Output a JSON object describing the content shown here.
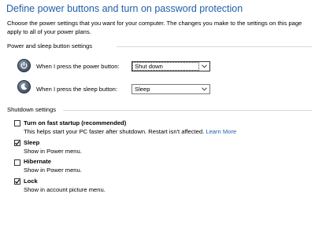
{
  "page": {
    "title": "Define power buttons and turn on password protection",
    "intro": "Choose the power settings that you want for your computer. The changes you make to the settings on this page apply to all of your power plans."
  },
  "power_group": {
    "header": "Power and sleep button settings",
    "power_button": {
      "label": "When I press the power button:",
      "value": "Shut down",
      "icon": "power-button-icon"
    },
    "sleep_button": {
      "label": "When I press the sleep button:",
      "value": "Sleep",
      "icon": "sleep-button-icon"
    }
  },
  "shutdown_group": {
    "header": "Shutdown settings",
    "options": [
      {
        "title": "Turn on fast startup (recommended)",
        "desc": "This helps start your PC faster after shutdown. Restart isn't affected.",
        "link": "Learn More",
        "checked": false
      },
      {
        "title": "Sleep",
        "desc": "Show in Power menu.",
        "checked": true
      },
      {
        "title": "Hibernate",
        "desc": "Show in Power menu.",
        "checked": false
      },
      {
        "title": "Lock",
        "desc": "Show in account picture menu.",
        "checked": true
      }
    ]
  },
  "colors": {
    "title": "#1f5fa8",
    "link": "#1f5fa8",
    "rule": "#d9d9d9"
  }
}
